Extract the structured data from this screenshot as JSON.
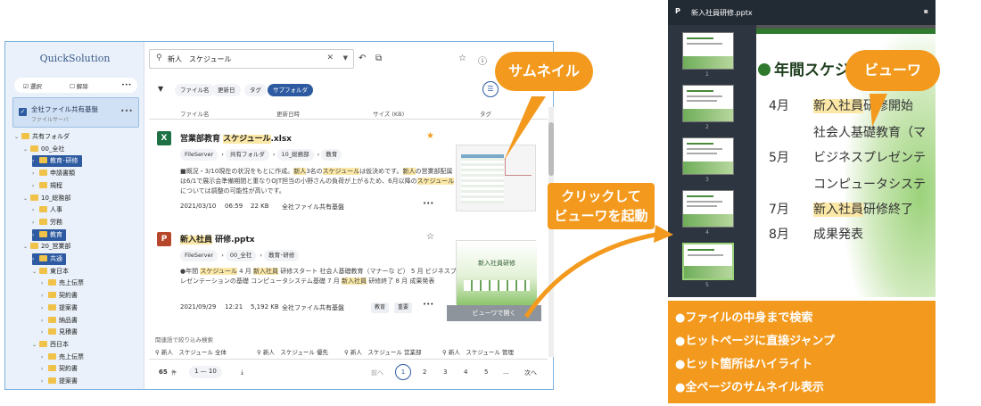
{
  "app": {
    "logo": "QuickSolution",
    "select_btn": "選択",
    "clear_btn": "解除",
    "selected_card": {
      "title": "全社ファイル共有基盤",
      "subtitle": "ファイルサーバ"
    },
    "tree": [
      {
        "label": "共有フォルダ",
        "level": 0,
        "open": true,
        "hl": false
      },
      {
        "label": "00_全社",
        "level": 1,
        "open": true,
        "hl": false
      },
      {
        "label": "教育･研修",
        "level": 2,
        "open": false,
        "hl": true
      },
      {
        "label": "申請書類",
        "level": 2,
        "open": false,
        "hl": false
      },
      {
        "label": "規程",
        "level": 2,
        "open": false,
        "hl": false
      },
      {
        "label": "10_総務部",
        "level": 1,
        "open": true,
        "hl": false
      },
      {
        "label": "人事",
        "level": 2,
        "open": false,
        "hl": false
      },
      {
        "label": "労務",
        "level": 2,
        "open": false,
        "hl": false
      },
      {
        "label": "教育",
        "level": 2,
        "open": false,
        "hl": true
      },
      {
        "label": "20_営業部",
        "level": 1,
        "open": true,
        "hl": false
      },
      {
        "label": "共通",
        "level": 2,
        "open": false,
        "hl": true
      },
      {
        "label": "東日本",
        "level": 2,
        "open": true,
        "hl": false
      },
      {
        "label": "売上伝票",
        "level": 3,
        "open": false,
        "hl": false
      },
      {
        "label": "契約書",
        "level": 3,
        "open": false,
        "hl": false
      },
      {
        "label": "提案書",
        "level": 3,
        "open": false,
        "hl": false
      },
      {
        "label": "納品書",
        "level": 3,
        "open": false,
        "hl": false
      },
      {
        "label": "見積書",
        "level": 3,
        "open": false,
        "hl": false
      },
      {
        "label": "西日本",
        "level": 2,
        "open": true,
        "hl": false
      },
      {
        "label": "売上伝票",
        "level": 3,
        "open": false,
        "hl": false
      },
      {
        "label": "契約書",
        "level": 3,
        "open": false,
        "hl": false
      },
      {
        "label": "提案書",
        "level": 3,
        "open": false,
        "hl": false
      }
    ],
    "search": {
      "value": "新人　スケジュール"
    },
    "filters": [
      "ファイル名",
      "更新日",
      "タグ",
      "サブフォルダ"
    ],
    "columns": {
      "name": "ファイル名",
      "updated": "更新日時",
      "size": "サイズ (KB)",
      "tag": "タグ"
    },
    "results": [
      {
        "icon": "X",
        "title_a": "営業部教育 ",
        "title_hl": "スケジュール",
        "title_b": ".xlsx",
        "crumbs": [
          "FileServer",
          "共有フォルダ",
          "10_総務部",
          "教育"
        ],
        "snippet_html_parts": [
          "■概況・3/10現在の状況をもとに作成。",
          "新人",
          "3名の",
          "スケジュール",
          "は仮決めです。",
          "新人",
          "の営業部配属は6/1で展示会準備期間と重なりOJT担当の小野さんの負荷が上がるため、6月以降の",
          "スケジュール",
          "については調整の可能性が高いです。"
        ],
        "date": "2021/03/10",
        "time": "06:59",
        "size": "22 KB",
        "location": "全社ファイル共有基盤"
      },
      {
        "icon": "P",
        "title_hl": "新入社員",
        "title_b": " 研修.pptx",
        "crumbs": [
          "FileServer",
          "00_全社",
          "教育･研修"
        ],
        "snippet_html_parts": [
          "●年間 ",
          "スケジュール",
          " 4 月 ",
          "新入社員",
          " 研修スタート 社会人基礎教育（マナーな ど） 5 月 ビジネスプレゼンテーションの基礎 コンピュータシステム基礎 7 月 ",
          "新入社員",
          " 研修終了 8 月 成果発表"
        ],
        "date": "2021/09/29",
        "time": "12:21",
        "size": "5,192 KB",
        "location": "全社ファイル共有基盤",
        "tags": [
          "教育",
          "重要"
        ],
        "thumb_text": "新入社員研修"
      }
    ],
    "viewer_btn": "ビューワで開く",
    "related_label": "関連語で絞り込み検索",
    "related": [
      "新人　スケジュール 全体",
      "新人　スケジュール 優先",
      "新人　スケジュール 営業部",
      "新人　スケジュール 管理"
    ],
    "pagination": {
      "count": "65",
      "count_unit": "件",
      "range": "1 — 10",
      "prev": "前へ",
      "pages": [
        "1",
        "2",
        "3",
        "4",
        "5",
        "..."
      ],
      "next": "次へ"
    }
  },
  "callouts": {
    "thumbnail": "サムネイル",
    "viewer": "ビューワ",
    "click": "クリックして\nビューワを起動"
  },
  "viewer": {
    "filename": "新入社員研修.pptx",
    "thumb_nums": [
      "1",
      "2",
      "3",
      "4",
      "5"
    ],
    "slide_title": "年間スケジュ",
    "lines": [
      {
        "month": "4月",
        "text_hl": "新入社員",
        "text": "研修開始"
      },
      {
        "month": "",
        "text": "社会人基礎教育（マ"
      },
      {
        "month": "5月",
        "text": "ビジネスプレゼンテ"
      },
      {
        "month": "",
        "text": "コンピュータシステ"
      },
      {
        "month": "7月",
        "text_hl": "新入社員",
        "text": "研修終了"
      },
      {
        "month": "8月",
        "text": "成果発表"
      }
    ]
  },
  "features": [
    "●ファイルの中身まで検索",
    "●ヒットページに直接ジャンプ",
    "●ヒット箇所はハイライト",
    "●全ページのサムネイル表示"
  ],
  "colors": {
    "accent": "#2d5aa0",
    "callout": "#f39a1e"
  }
}
